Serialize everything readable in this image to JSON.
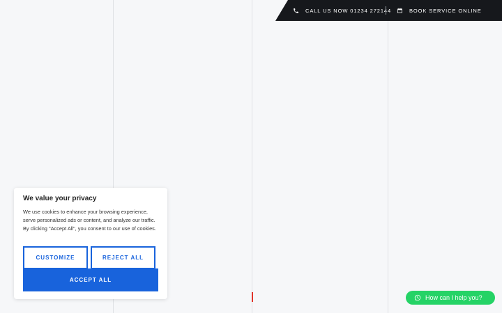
{
  "topbar": {
    "call_label": "CALL US NOW 01234 272144",
    "book_label": "BOOK SERVICE ONLINE"
  },
  "cookie": {
    "title": "We value your privacy",
    "body": "We use cookies to enhance your browsing experience, serve personalized ads or content, and analyze our traffic. By clicking \"Accept All\", you consent to our use of cookies.",
    "customize_label": "CUSTOMIZE",
    "reject_label": "REJECT ALL",
    "accept_label": "ACCEPT ALL"
  },
  "chat": {
    "label": "How can I help you?"
  },
  "colors": {
    "accent": "#1863dc",
    "chat": "#25d366",
    "topbar": "#16181c"
  }
}
